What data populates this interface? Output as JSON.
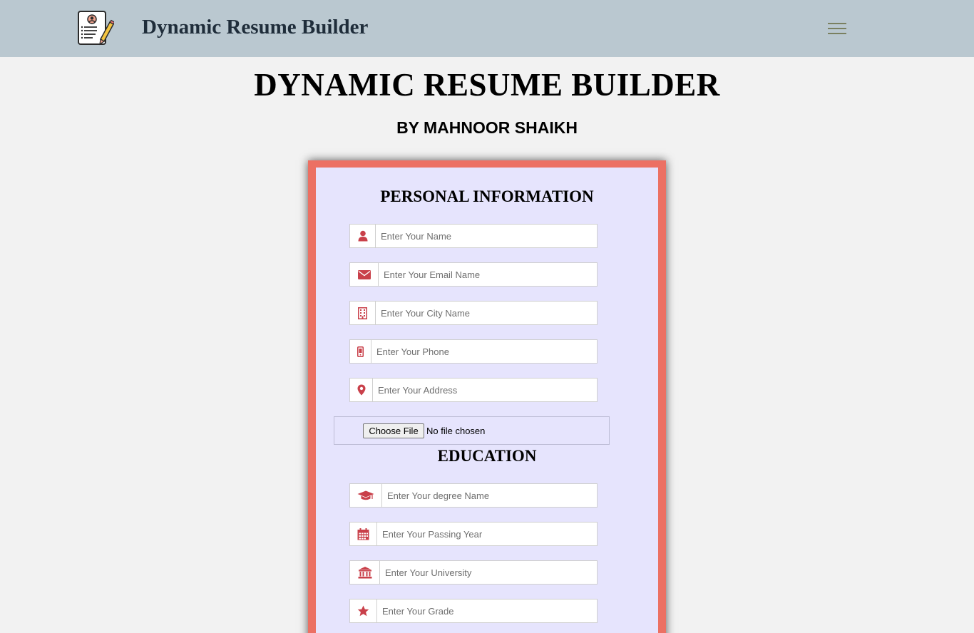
{
  "navbar": {
    "brand": "Dynamic Resume Builder",
    "logo_icon": "resume-pencil-icon",
    "menu_icon": "hamburger-icon",
    "background": "#bac8d0"
  },
  "header": {
    "title": "DYNAMIC RESUME BUILDER",
    "byline": "BY MAHNOOR SHAIKH"
  },
  "form": {
    "accent_color": "#ec7063",
    "panel_color": "#e6e4fd",
    "icon_color": "#c9404a",
    "personal": {
      "title": "PERSONAL INFORMATION",
      "fields": [
        {
          "icon": "user-icon",
          "placeholder": "Enter Your Name"
        },
        {
          "icon": "envelope-icon",
          "placeholder": "Enter Your Email Name"
        },
        {
          "icon": "building-icon",
          "placeholder": "Enter Your City Name"
        },
        {
          "icon": "mobile-phone-icon",
          "placeholder": "Enter Your Phone"
        },
        {
          "icon": "map-marker-icon",
          "placeholder": "Enter Your Address"
        }
      ],
      "file": {
        "button": "Choose File",
        "status": "No file chosen"
      }
    },
    "education": {
      "title": "EDUCATION",
      "fields": [
        {
          "icon": "graduation-cap-icon",
          "placeholder": "Enter Your degree Name"
        },
        {
          "icon": "calendar-icon",
          "placeholder": "Enter Your Passing Year"
        },
        {
          "icon": "university-icon",
          "placeholder": "Enter Your University"
        },
        {
          "icon": "star-icon",
          "placeholder": "Enter Your Grade"
        }
      ]
    }
  }
}
